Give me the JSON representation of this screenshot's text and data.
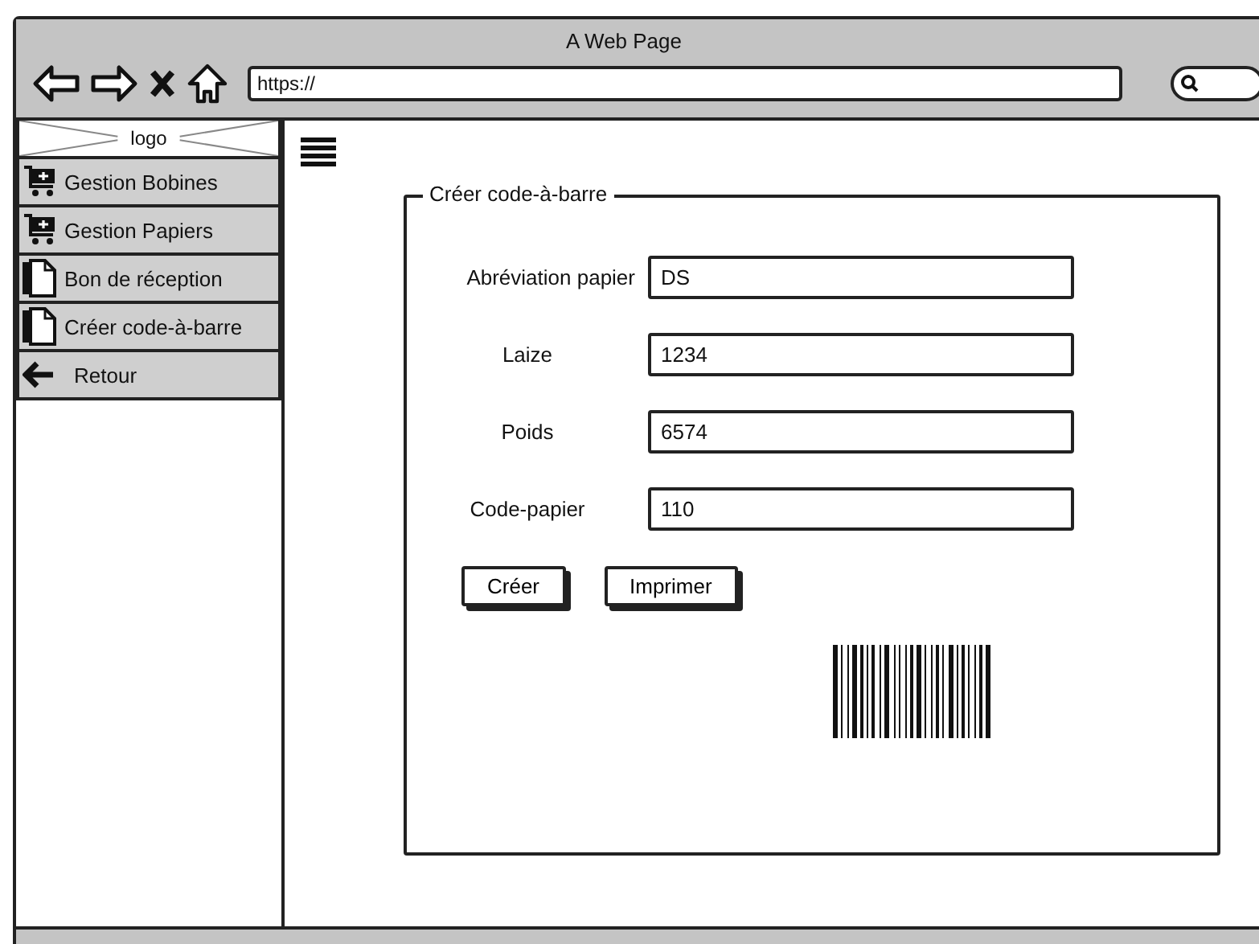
{
  "window": {
    "title": "A Web Page",
    "url": "https://"
  },
  "sidebar": {
    "logo": "logo",
    "items": [
      {
        "label": "Gestion Bobines",
        "kind": "cart"
      },
      {
        "label": "Gestion Papiers",
        "kind": "cart"
      },
      {
        "label": "Bon de réception",
        "kind": "document"
      },
      {
        "label": "Créer code-à-barre",
        "kind": "document"
      },
      {
        "label": "Retour",
        "kind": "back"
      }
    ]
  },
  "form": {
    "title": "Créer code-à-barre",
    "fields": [
      {
        "label": "Abréviation papier",
        "value": "DS"
      },
      {
        "label": "Laize",
        "value": "1234"
      },
      {
        "label": "Poids",
        "value": "6574"
      },
      {
        "label": "Code-papier",
        "value": "110"
      }
    ],
    "buttons": [
      "Créer",
      "Imprimer"
    ]
  }
}
